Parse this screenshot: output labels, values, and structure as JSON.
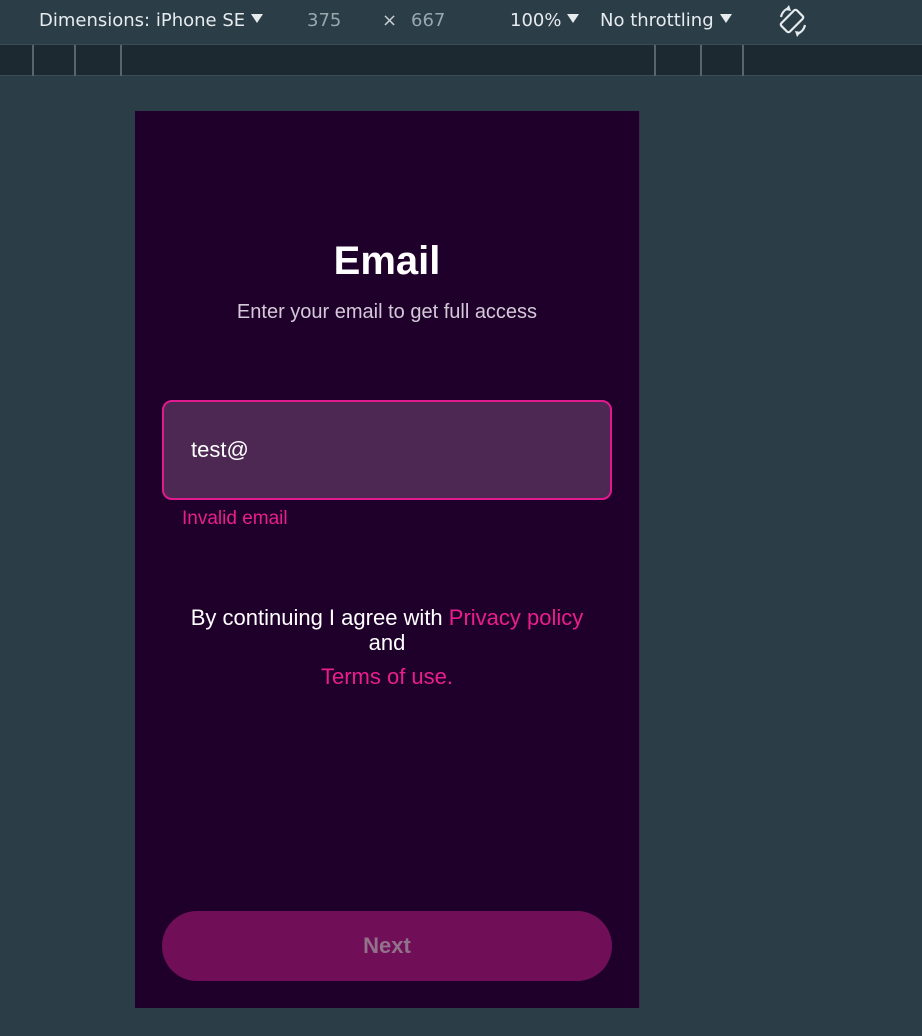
{
  "devtools": {
    "dimensions_label": "Dimensions: iPhone SE",
    "width": "375",
    "times": "×",
    "height": "667",
    "zoom": "100%",
    "throttling": "No throttling",
    "rotate_icon": "rotate-icon"
  },
  "screen": {
    "title": "Email",
    "subtitle": "Enter your email to get full access",
    "email_value": "test@",
    "error": "Invalid email",
    "consent_prefix": "By continuing I agree with ",
    "privacy_link": "Privacy policy",
    "consent_and": "and",
    "terms_link": "Terms of use.",
    "next_label": "Next"
  },
  "colors": {
    "background": "#2b3d47",
    "phone_bg": "#1f002b",
    "accent": "#e91e8c",
    "input_bg": "#4c2853",
    "button_bg": "#700f58"
  }
}
